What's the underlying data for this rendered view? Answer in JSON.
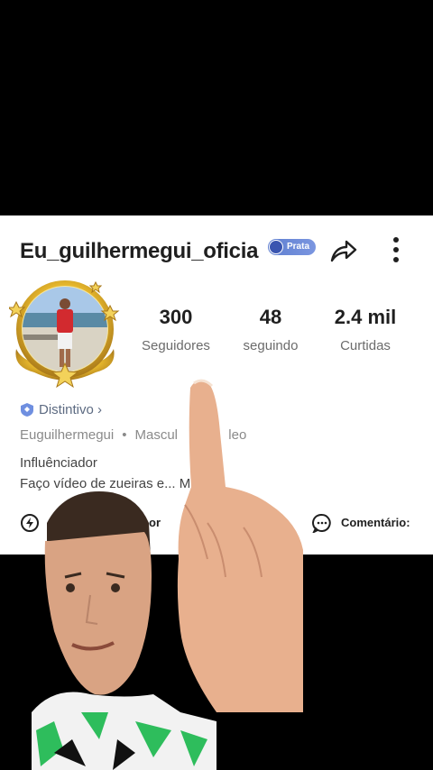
{
  "profile": {
    "username": "Eu_guilhermegui_oficia",
    "badge_label": "Prata",
    "stats": [
      {
        "value": "300",
        "label": "Seguidores"
      },
      {
        "value": "48",
        "label": "seguindo"
      },
      {
        "value": "2.4 mil",
        "label": "Curtidas"
      }
    ],
    "distintivo": "Distintivo",
    "meta": {
      "name": "Euguilhermegui",
      "gender": "Mascul",
      "sign": "leo"
    },
    "category": "Influênciador",
    "bio": "Faço vídeo de zueiras e... M",
    "actions": {
      "left_label": "or",
      "comments_label": "Comentário:"
    }
  },
  "icons": {
    "share": "share-arrow-icon",
    "more": "more-vertical-icon",
    "distintivo": "shield-icon",
    "comments": "chat-bubble-icon",
    "left_action": "bolt-circle-icon"
  },
  "colors": {
    "badge": "#6a86d6",
    "card_bg": "#ffffff",
    "text_dark": "#1f1f1f",
    "text_gray": "#8a8a8a"
  }
}
